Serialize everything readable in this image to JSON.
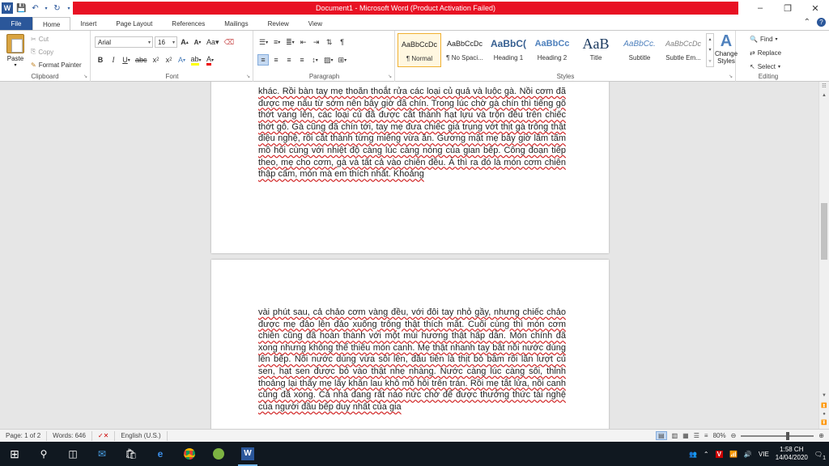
{
  "title_bar": {
    "title": "Document1 - Microsoft Word (Product Activation Failed)",
    "minimize_icon": "minimize-icon",
    "maximize_icon": "restore-icon",
    "close_icon": "close-icon"
  },
  "tabs": [
    "File",
    "Home",
    "Insert",
    "Page Layout",
    "References",
    "Mailings",
    "Review",
    "View"
  ],
  "active_tab": "Home",
  "clipboard": {
    "paste": "Paste",
    "cut": "Cut",
    "copy": "Copy",
    "format_painter": "Format Painter",
    "label": "Clipboard"
  },
  "font": {
    "name": "Arial",
    "size": "16",
    "label": "Font"
  },
  "paragraph": {
    "label": "Paragraph"
  },
  "styles": {
    "items": [
      {
        "sample": "AaBbCcDc",
        "name": "¶ Normal"
      },
      {
        "sample": "AaBbCcDc",
        "name": "¶ No Spaci..."
      },
      {
        "sample": "AaBbC(",
        "name": "Heading 1"
      },
      {
        "sample": "AaBbCc",
        "name": "Heading 2"
      },
      {
        "sample": "AaB",
        "name": "Title"
      },
      {
        "sample": "AaBbCc.",
        "name": "Subtitle"
      },
      {
        "sample": "AaBbCcDc",
        "name": "Subtle Em..."
      }
    ],
    "change_styles": "Change Styles",
    "label": "Styles"
  },
  "editing": {
    "find": "Find",
    "replace": "Replace",
    "select": "Select",
    "label": "Editing"
  },
  "document": {
    "page1_text": "khác. Rồi bàn tay mẹ thoăn thoắt rửa các loại củ quả và luộc gà. Nồi cơm đã được mẹ nấu từ sớm nên bây giờ đã chín. Trong lúc chờ gà chín thì tiếng gõ thớt vang lên, các loại củ đã được cắt thành hạt lựu và trộn đều trên chiếc thớt gỗ. Gà cũng đã chín tới, tay mẹ đưa chiếc giá trụng vớt thịt gà trông thật điệu nghệ, rồi cắt thành từng miếng vừa ăn. Gương mặt mẹ bây giờ lấm tấm mồ hôi cùng với nhiệt độ càng lúc càng nóng của gian bếp. Công đoạn tiếp theo, mẹ cho cơm, gà và tất cả vào chiên đều. À thì ra đó là món cơm chiên thập cẩm, món mà em thích nhất. Khoảng",
    "page2_text": "vài phút sau, cả chảo cơm vàng đều, với đôi tay nhỏ gầy, nhưng chiếc chảo được mẹ đảo lên đảo xuống trông thật thích mắt. Cuối cùng thì món cơm chiên cũng đã hoàn thành với một mùi hương thật hấp dẫn. Món chính đã xong nhưng không thể thiếu món canh. Mẹ thật nhanh tay bắt nồi nước dùng lên bếp. Nồi nước dùng vừa sôi lên, đầu tiên là thịt bò bằm rồi lần lượt củ sen, hạt sen được bỏ vào thật nhẹ nhàng. Nước càng lúc càng sôi, thỉnh thoảng lại thấy mẹ lấy khăn lau khô mồ hôi trên trán. Rồi mẹ tắt lửa, nồi canh cũng đã xong. Cả nhà đang rất náo nức chờ để được thưởng thức tài nghệ của người đầu bếp duy nhất của gia"
  },
  "status_bar": {
    "page": "Page: 1 of 2",
    "words": "Words: 646",
    "language": "English (U.S.)",
    "zoom": "80%"
  },
  "taskbar": {
    "language": "VIE",
    "time": "1:58 CH",
    "date": "14/04/2020",
    "notification_count": "1"
  }
}
